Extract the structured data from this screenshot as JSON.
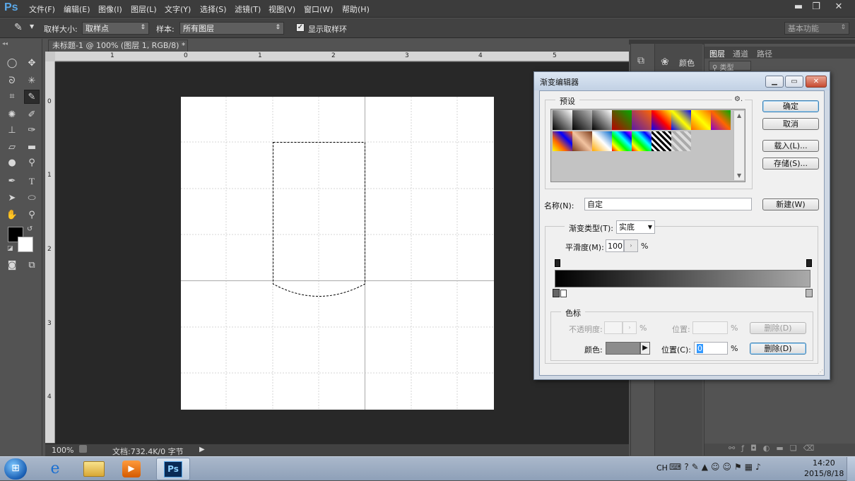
{
  "app": {
    "logo": "Ps"
  },
  "menu": [
    "文件(F)",
    "编辑(E)",
    "图像(I)",
    "图层(L)",
    "文字(Y)",
    "选择(S)",
    "滤镜(T)",
    "视图(V)",
    "窗口(W)",
    "帮助(H)"
  ],
  "window_controls": {
    "minimize": "▬",
    "restore": "❐",
    "close": "✕"
  },
  "options": {
    "sample_size_label": "取样大小:",
    "sample_size_value": "取样点",
    "sample_label": "样本:",
    "sample_value": "所有图层",
    "show_ring_label": "显示取样环",
    "show_ring_checked": true,
    "workspace": "基本功能"
  },
  "document": {
    "tab_title": "未标题-1 @ 100% (图层 1, RGB/8) *",
    "ruler_h": [
      "0",
      "1",
      "2",
      "3",
      "4",
      "5",
      "1"
    ],
    "ruler_v": [
      "0",
      "1",
      "2",
      "3",
      "4"
    ]
  },
  "status": {
    "zoom": "100%",
    "doc_info": "文档:732.4K/0 字节"
  },
  "panels": {
    "color_tab": "颜色",
    "layers_tabs": [
      "图层",
      "通道",
      "路径"
    ],
    "layers_filter": "类型"
  },
  "dialog": {
    "title": "渐变编辑器",
    "presets_label": "预设",
    "name_label": "名称(N):",
    "name_value": "自定",
    "ok": "确定",
    "cancel": "取消",
    "load": "载入(L)...",
    "save": "存储(S)...",
    "new": "新建(W)",
    "type_label": "渐变类型(T):",
    "type_value": "实底",
    "smooth_label": "平滑度(M):",
    "smooth_value": "100",
    "percent": "%",
    "stops_label": "色标",
    "opacity_label": "不透明度:",
    "location_label": "位置:",
    "delete_disabled": "删除(D)",
    "color_label": "颜色:",
    "location_c_label": "位置(C):",
    "location_c_value": "0",
    "delete": "删除(D)",
    "swatch_color": "#8c8c8c"
  },
  "taskbar": {
    "lang": "CH",
    "time": "14:20",
    "date": "2015/8/18"
  }
}
